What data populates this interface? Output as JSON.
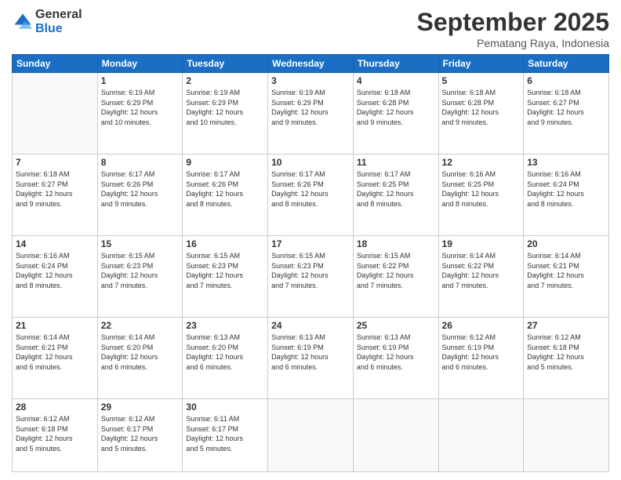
{
  "header": {
    "logo_line1": "General",
    "logo_line2": "Blue",
    "month": "September 2025",
    "location": "Pematang Raya, Indonesia"
  },
  "weekdays": [
    "Sunday",
    "Monday",
    "Tuesday",
    "Wednesday",
    "Thursday",
    "Friday",
    "Saturday"
  ],
  "weeks": [
    [
      {
        "day": "",
        "info": ""
      },
      {
        "day": "1",
        "info": "Sunrise: 6:19 AM\nSunset: 6:29 PM\nDaylight: 12 hours\nand 10 minutes."
      },
      {
        "day": "2",
        "info": "Sunrise: 6:19 AM\nSunset: 6:29 PM\nDaylight: 12 hours\nand 10 minutes."
      },
      {
        "day": "3",
        "info": "Sunrise: 6:19 AM\nSunset: 6:29 PM\nDaylight: 12 hours\nand 9 minutes."
      },
      {
        "day": "4",
        "info": "Sunrise: 6:18 AM\nSunset: 6:28 PM\nDaylight: 12 hours\nand 9 minutes."
      },
      {
        "day": "5",
        "info": "Sunrise: 6:18 AM\nSunset: 6:28 PM\nDaylight: 12 hours\nand 9 minutes."
      },
      {
        "day": "6",
        "info": "Sunrise: 6:18 AM\nSunset: 6:27 PM\nDaylight: 12 hours\nand 9 minutes."
      }
    ],
    [
      {
        "day": "7",
        "info": "Sunrise: 6:18 AM\nSunset: 6:27 PM\nDaylight: 12 hours\nand 9 minutes."
      },
      {
        "day": "8",
        "info": "Sunrise: 6:17 AM\nSunset: 6:26 PM\nDaylight: 12 hours\nand 9 minutes."
      },
      {
        "day": "9",
        "info": "Sunrise: 6:17 AM\nSunset: 6:26 PM\nDaylight: 12 hours\nand 8 minutes."
      },
      {
        "day": "10",
        "info": "Sunrise: 6:17 AM\nSunset: 6:26 PM\nDaylight: 12 hours\nand 8 minutes."
      },
      {
        "day": "11",
        "info": "Sunrise: 6:17 AM\nSunset: 6:25 PM\nDaylight: 12 hours\nand 8 minutes."
      },
      {
        "day": "12",
        "info": "Sunrise: 6:16 AM\nSunset: 6:25 PM\nDaylight: 12 hours\nand 8 minutes."
      },
      {
        "day": "13",
        "info": "Sunrise: 6:16 AM\nSunset: 6:24 PM\nDaylight: 12 hours\nand 8 minutes."
      }
    ],
    [
      {
        "day": "14",
        "info": "Sunrise: 6:16 AM\nSunset: 6:24 PM\nDaylight: 12 hours\nand 8 minutes."
      },
      {
        "day": "15",
        "info": "Sunrise: 6:15 AM\nSunset: 6:23 PM\nDaylight: 12 hours\nand 7 minutes."
      },
      {
        "day": "16",
        "info": "Sunrise: 6:15 AM\nSunset: 6:23 PM\nDaylight: 12 hours\nand 7 minutes."
      },
      {
        "day": "17",
        "info": "Sunrise: 6:15 AM\nSunset: 6:23 PM\nDaylight: 12 hours\nand 7 minutes."
      },
      {
        "day": "18",
        "info": "Sunrise: 6:15 AM\nSunset: 6:22 PM\nDaylight: 12 hours\nand 7 minutes."
      },
      {
        "day": "19",
        "info": "Sunrise: 6:14 AM\nSunset: 6:22 PM\nDaylight: 12 hours\nand 7 minutes."
      },
      {
        "day": "20",
        "info": "Sunrise: 6:14 AM\nSunset: 6:21 PM\nDaylight: 12 hours\nand 7 minutes."
      }
    ],
    [
      {
        "day": "21",
        "info": "Sunrise: 6:14 AM\nSunset: 6:21 PM\nDaylight: 12 hours\nand 6 minutes."
      },
      {
        "day": "22",
        "info": "Sunrise: 6:14 AM\nSunset: 6:20 PM\nDaylight: 12 hours\nand 6 minutes."
      },
      {
        "day": "23",
        "info": "Sunrise: 6:13 AM\nSunset: 6:20 PM\nDaylight: 12 hours\nand 6 minutes."
      },
      {
        "day": "24",
        "info": "Sunrise: 6:13 AM\nSunset: 6:19 PM\nDaylight: 12 hours\nand 6 minutes."
      },
      {
        "day": "25",
        "info": "Sunrise: 6:13 AM\nSunset: 6:19 PM\nDaylight: 12 hours\nand 6 minutes."
      },
      {
        "day": "26",
        "info": "Sunrise: 6:12 AM\nSunset: 6:19 PM\nDaylight: 12 hours\nand 6 minutes."
      },
      {
        "day": "27",
        "info": "Sunrise: 6:12 AM\nSunset: 6:18 PM\nDaylight: 12 hours\nand 5 minutes."
      }
    ],
    [
      {
        "day": "28",
        "info": "Sunrise: 6:12 AM\nSunset: 6:18 PM\nDaylight: 12 hours\nand 5 minutes."
      },
      {
        "day": "29",
        "info": "Sunrise: 6:12 AM\nSunset: 6:17 PM\nDaylight: 12 hours\nand 5 minutes."
      },
      {
        "day": "30",
        "info": "Sunrise: 6:11 AM\nSunset: 6:17 PM\nDaylight: 12 hours\nand 5 minutes."
      },
      {
        "day": "",
        "info": ""
      },
      {
        "day": "",
        "info": ""
      },
      {
        "day": "",
        "info": ""
      },
      {
        "day": "",
        "info": ""
      }
    ]
  ]
}
